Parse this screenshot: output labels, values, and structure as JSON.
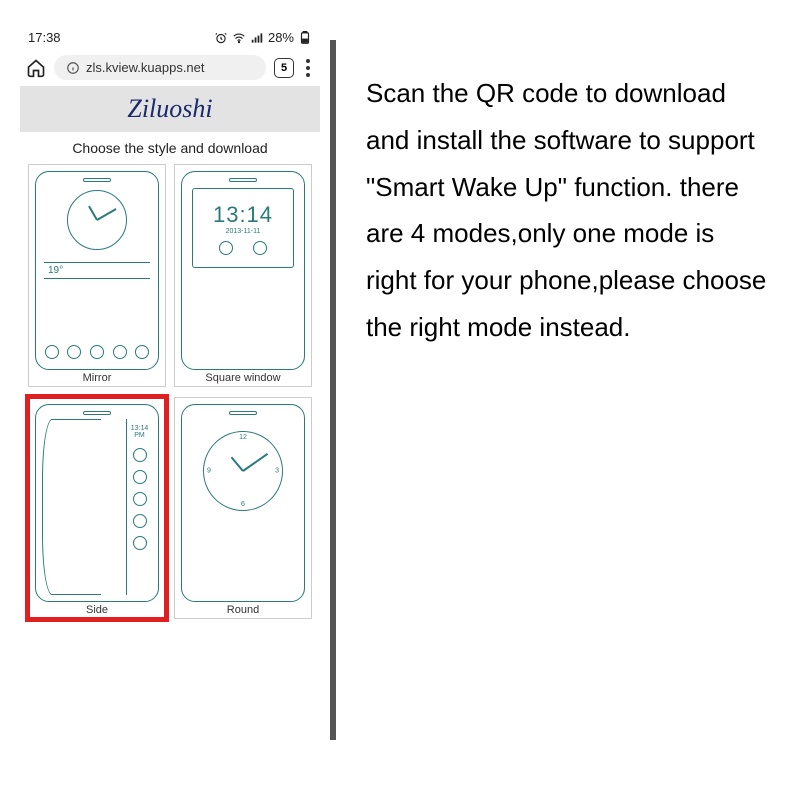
{
  "status": {
    "time": "17:38",
    "battery_text": "28%"
  },
  "browser": {
    "url": "zls.kview.kuapps.net",
    "tab_count": "5"
  },
  "page": {
    "brand": "Ziluoshi",
    "subtitle": "Choose the style and download"
  },
  "styles": [
    {
      "label": "Mirror",
      "temp": "19°"
    },
    {
      "label": "Square window",
      "time": "13:14",
      "date": "2013-11-11"
    },
    {
      "label": "Side",
      "time": "13:14",
      "ampm": "PM"
    },
    {
      "label": "Round"
    }
  ],
  "instructions": {
    "text": "Scan the QR code to download and install the software to support \"Smart Wake Up\" function. there are 4 modes,only one mode is right for your phone,please choose the right mode instead."
  }
}
